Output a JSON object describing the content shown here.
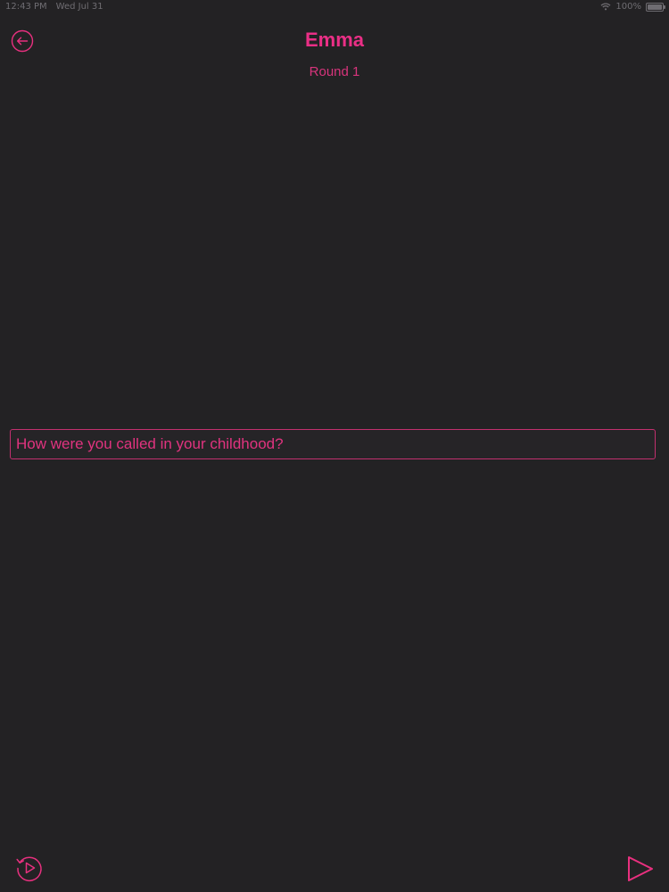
{
  "status_bar": {
    "time": "12:43 PM",
    "date": "Wed Jul 31",
    "battery": "100%"
  },
  "header": {
    "title": "Emma",
    "round": "Round 1"
  },
  "question": {
    "text": "How were you called in your childhood?"
  },
  "icons": {
    "back": "arrow-left-circle-icon",
    "replay": "replay-icon",
    "play": "play-triangle-icon",
    "wifi": "wifi-icon",
    "battery": "battery-icon"
  },
  "colors": {
    "background": "#232224",
    "accent": "#ea2f86"
  }
}
